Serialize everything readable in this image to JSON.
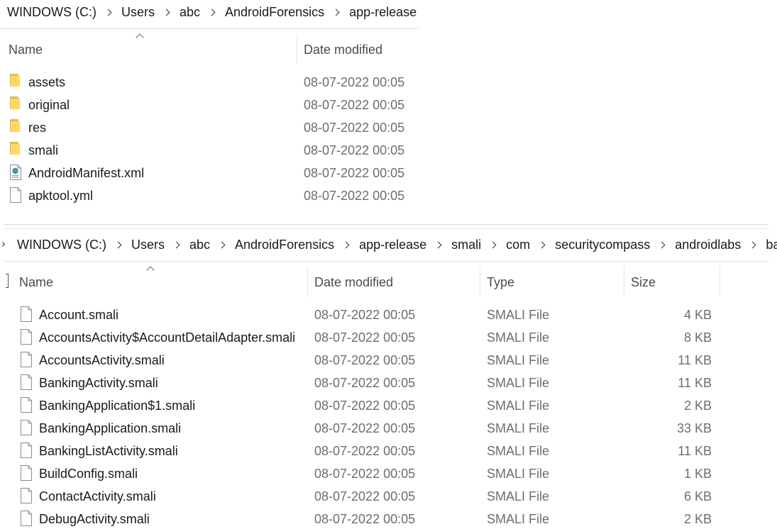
{
  "top_window": {
    "breadcrumb": [
      "WINDOWS (C:)",
      "Users",
      "abc",
      "AndroidForensics",
      "app-release"
    ],
    "headers": {
      "name": "Name",
      "date_modified": "Date modified"
    },
    "items": [
      {
        "name": "assets",
        "date": "08-07-2022 00:05",
        "icon": "folder-icon"
      },
      {
        "name": "original",
        "date": "08-07-2022 00:05",
        "icon": "folder-icon"
      },
      {
        "name": "res",
        "date": "08-07-2022 00:05",
        "icon": "folder-icon"
      },
      {
        "name": "smali",
        "date": "08-07-2022 00:05",
        "icon": "folder-icon"
      },
      {
        "name": "AndroidManifest.xml",
        "date": "08-07-2022 00:05",
        "icon": "xml-file-icon"
      },
      {
        "name": "apktool.yml",
        "date": "08-07-2022 00:05",
        "icon": "file-icon"
      }
    ]
  },
  "bottom_window": {
    "breadcrumb": [
      "WINDOWS (C:)",
      "Users",
      "abc",
      "AndroidForensics",
      "app-release",
      "smali",
      "com",
      "securitycompass",
      "androidlabs",
      "base"
    ],
    "headers": {
      "name": "Name",
      "date_modified": "Date modified",
      "type": "Type",
      "size": "Size"
    },
    "items": [
      {
        "name": "Account.smali",
        "date": "08-07-2022 00:05",
        "type": "SMALI File",
        "size": "4 KB"
      },
      {
        "name": "AccountsActivity$AccountDetailAdapter.smali",
        "date": "08-07-2022 00:05",
        "type": "SMALI File",
        "size": "8 KB"
      },
      {
        "name": "AccountsActivity.smali",
        "date": "08-07-2022 00:05",
        "type": "SMALI File",
        "size": "11 KB"
      },
      {
        "name": "BankingActivity.smali",
        "date": "08-07-2022 00:05",
        "type": "SMALI File",
        "size": "11 KB"
      },
      {
        "name": "BankingApplication$1.smali",
        "date": "08-07-2022 00:05",
        "type": "SMALI File",
        "size": "2 KB"
      },
      {
        "name": "BankingApplication.smali",
        "date": "08-07-2022 00:05",
        "type": "SMALI File",
        "size": "33 KB"
      },
      {
        "name": "BankingListActivity.smali",
        "date": "08-07-2022 00:05",
        "type": "SMALI File",
        "size": "11 KB"
      },
      {
        "name": "BuildConfig.smali",
        "date": "08-07-2022 00:05",
        "type": "SMALI File",
        "size": "1 KB"
      },
      {
        "name": "ContactActivity.smali",
        "date": "08-07-2022 00:05",
        "type": "SMALI File",
        "size": "6 KB"
      },
      {
        "name": "DebugActivity.smali",
        "date": "08-07-2022 00:05",
        "type": "SMALI File",
        "size": "2 KB"
      }
    ]
  }
}
